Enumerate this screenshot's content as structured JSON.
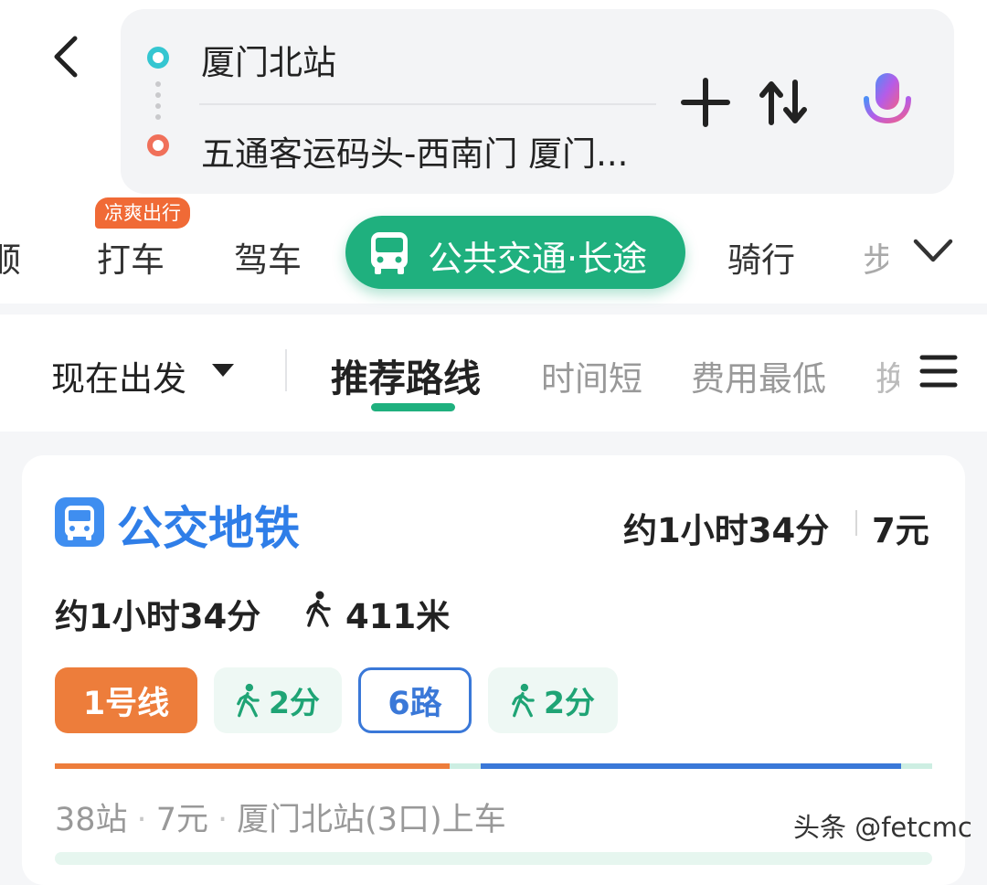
{
  "route": {
    "from": "厦门北站",
    "to": "五通客运码头-西南门 厦门..."
  },
  "modes": {
    "partial_left": "顺",
    "badge": "凉爽出行",
    "items": [
      "打车",
      "驾车"
    ],
    "active": "公共交通·长途",
    "after": "骑行",
    "partial_right": "步"
  },
  "options": {
    "depart": "现在出发",
    "active": "推荐路线",
    "items": [
      "时间短",
      "费用最低"
    ],
    "partial": "换"
  },
  "card": {
    "title": "公交地铁",
    "time": "约1小时34分",
    "price": "7元",
    "duration": "约1小时34分",
    "walk_distance": "411米",
    "segments": {
      "line1": "1号线",
      "walk1": "2分",
      "bus": "6路",
      "walk2": "2分"
    },
    "detail": {
      "stations": "38站",
      "fare": "7元",
      "board": "厦门北站(3口)上车"
    }
  },
  "watermark": "头条 @fetcmc",
  "colors": {
    "accent_green": "#1fb07e",
    "metro_orange": "#ed7d3b",
    "bus_blue": "#3a78d8",
    "title_blue": "#2f7ee8"
  }
}
